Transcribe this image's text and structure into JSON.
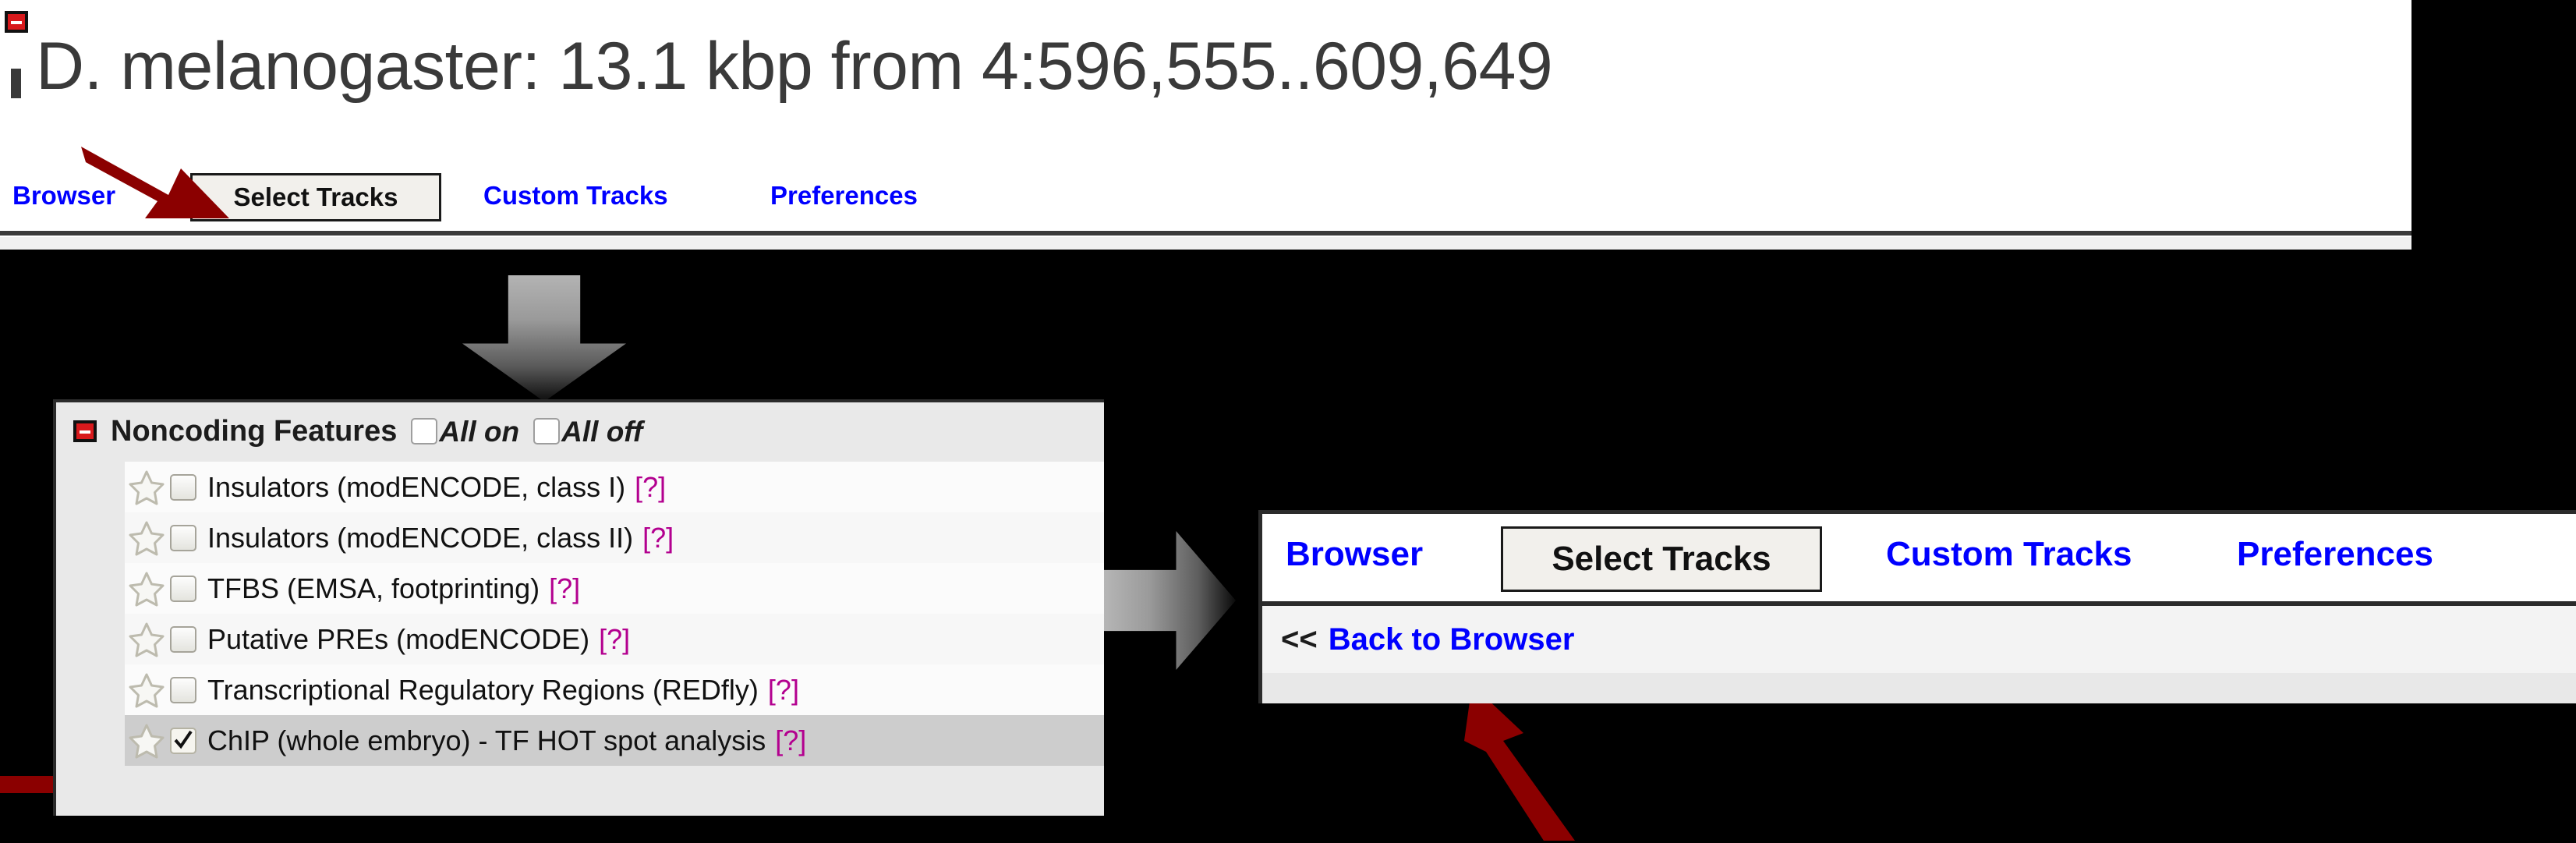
{
  "top_panel": {
    "minimize_icon": "minus-box-icon",
    "title": "D. melanogaster: 13.1 kbp from 4:596,555..609,649",
    "tabs": [
      {
        "label": "Browser",
        "selected": false
      },
      {
        "label": "Select Tracks",
        "selected": true
      },
      {
        "label": "Custom Tracks",
        "selected": false
      },
      {
        "label": "Preferences",
        "selected": false
      }
    ]
  },
  "noncoding_panel": {
    "collapse_icon": "minus-box-icon",
    "title": "Noncoding Features",
    "all_on_label": "All on",
    "all_off_label": "All off",
    "help_label": "[?]",
    "tracks": [
      {
        "label": "Insulators (modENCODE, class I)",
        "checked": false,
        "selected": false
      },
      {
        "label": "Insulators (modENCODE, class II)",
        "checked": false,
        "selected": false
      },
      {
        "label": "TFBS (EMSA, footprinting)",
        "checked": false,
        "selected": false
      },
      {
        "label": "Putative PREs (modENCODE)",
        "checked": false,
        "selected": false
      },
      {
        "label": "Transcriptional Regulatory Regions (REDfly)",
        "checked": false,
        "selected": false
      },
      {
        "label": "ChIP (whole embryo) - TF HOT spot analysis",
        "checked": true,
        "selected": true
      }
    ]
  },
  "right_panel": {
    "tabs": [
      {
        "label": "Browser",
        "selected": false
      },
      {
        "label": "Select Tracks",
        "selected": true
      },
      {
        "label": "Custom Tracks",
        "selected": false
      },
      {
        "label": "Preferences",
        "selected": false
      }
    ],
    "back_chevrons": "<<",
    "back_label": "Back to Browser"
  },
  "annotations": {
    "gray_arrow_down": "down-arrow-icon",
    "gray_arrow_right": "right-arrow-icon",
    "red_arrow_select_tracks": "pointer-arrow-icon",
    "red_arrow_chip_track": "pointer-arrow-icon",
    "red_arrow_back_to_browser": "pointer-arrow-icon"
  },
  "colors": {
    "link_blue": "#0000ff",
    "help_magenta": "#b3008f",
    "annotation_red": "#8b0000",
    "icon_red": "#d8191c",
    "title_gray": "#3a3a3a"
  }
}
